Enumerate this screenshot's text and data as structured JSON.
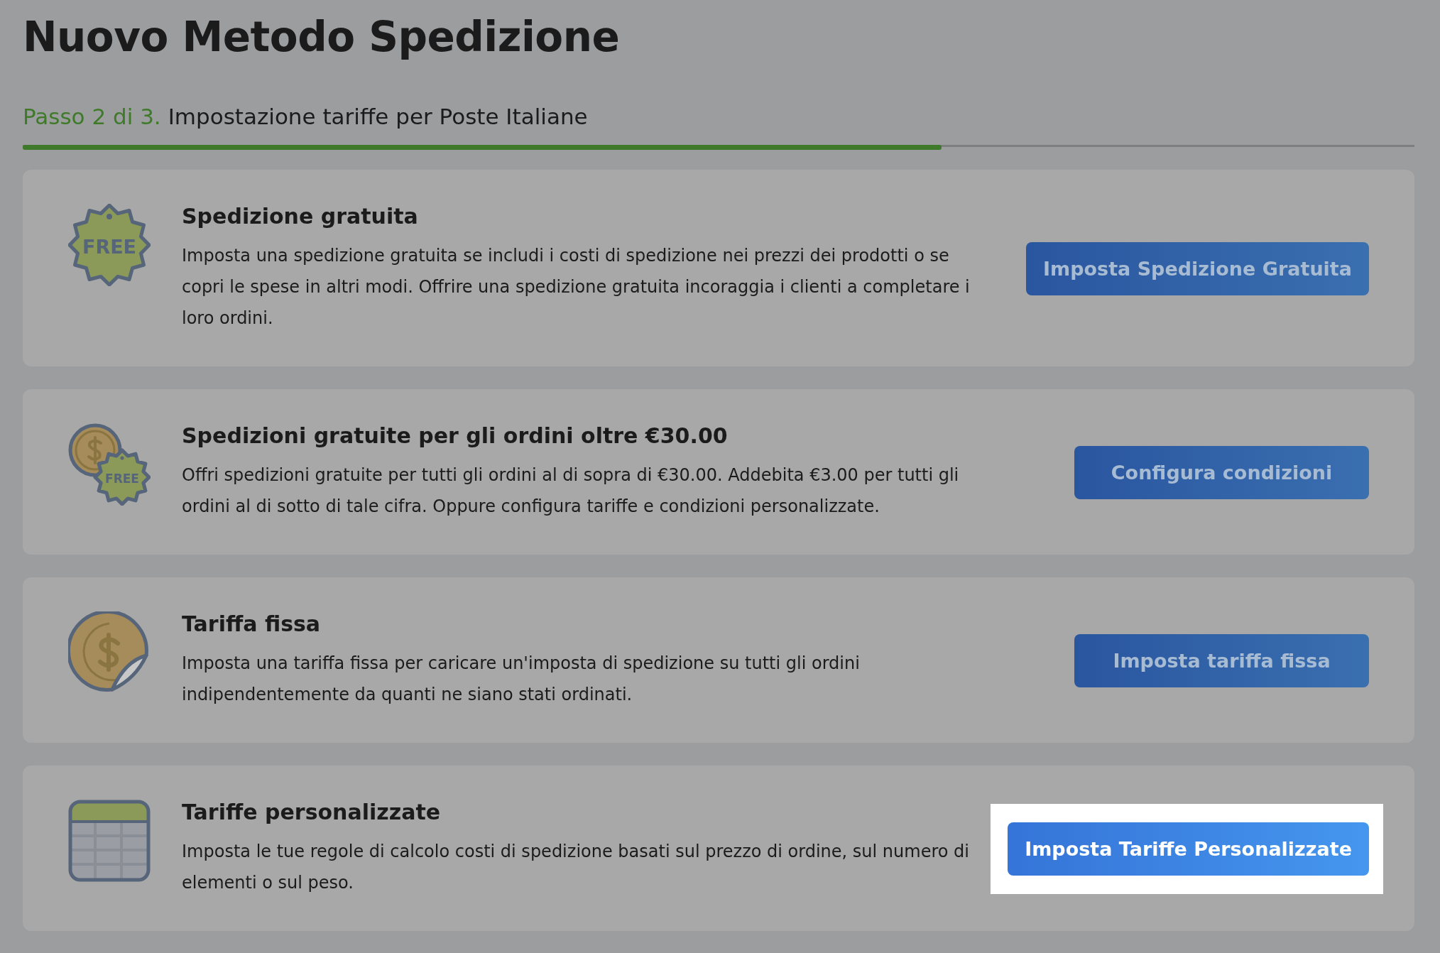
{
  "title": "Nuovo Metodo Spedizione",
  "step": {
    "counter": "Passo 2 di 3.",
    "label": "Impostazione tariffe per Poste Italiane",
    "level": 0.66
  },
  "options": [
    {
      "kind": "free-tag",
      "icon_text": "FREE",
      "heading": "Spedizione gratuita",
      "description": "Imposta una spedizione gratuita se includi i costi di spedizione nei prezzi dei prodotti o se copri le spese in altri modi. Offrire una spedizione gratuita incoraggia i clienti a completare i loro ordini.",
      "button": "Imposta Spedizione Gratuita",
      "highlighted": false
    },
    {
      "kind": "coin-tag",
      "icon_text": "FREE",
      "heading": "Spedizioni gratuite per gli ordini oltre €30.00",
      "description": "Offri spedizioni gratuite per tutti gli ordini al di sopra di €30.00. Addebita €3.00 per tutti gli ordini al di sotto di tale cifra. Oppure configura tariffe e condizioni personalizzate.",
      "button": "Configura condizioni",
      "highlighted": false
    },
    {
      "kind": "coin-sticker",
      "heading": "Tariffa fissa",
      "description": "Imposta una tariffa fissa per caricare un'imposta di spedizione su tutti gli ordini indipendentemente da quanti ne siano stati ordinati.",
      "button": "Imposta tariffa fissa",
      "highlighted": false
    },
    {
      "kind": "table",
      "heading": "Tariffe personalizzate",
      "description": "Imposta le tue regole di calcolo costi di spedizione basati sul prezzo di ordine, sul numero di elementi o sul peso.",
      "button": "Imposta Tariffe Personalizzate",
      "highlighted": true
    }
  ]
}
